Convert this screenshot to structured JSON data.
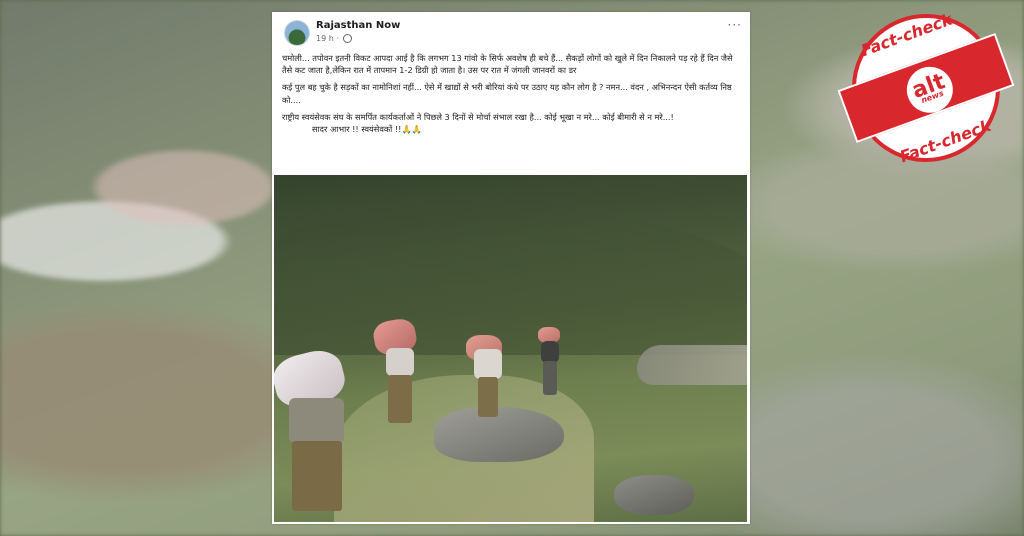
{
  "post": {
    "page_name": "Rajasthan Now",
    "time": "19 h ·",
    "more": "···",
    "paragraphs": [
      "चमोली... तपोवन इतनी विकट आपदा आई है कि लगभग 13 गांवो के सिर्फ अवशेष ही बचे हैं... सैकड़ों लोगों को खुले में दिन निकालने पड़ रहे हैं दिन जैसे तैसे कट जाता है,लेकिन रात में तापमान 1-2 डिग्री हो जाता है। उस पर रात में जंगली जानवरों का डर",
      "कई पुल बह चुके है सड़कों का नामोनिशां नहीं... ऐसे में खाद्यों से भरी बोरियां कंधे पर उठाए यह कौन लोग है ? नमन... वंदन , अभिनन्दन ऐसी कर्तव्य निष्ठ को....",
      "राष्ट्रीय स्वयंसेवक संघ के समर्पित कार्यकर्ताओं ने पिछले 3 दिनों से मोर्चा संभाल रखा है... कोई भूखा न मरे... कोई बीमारी से न मरे...!"
    ],
    "signoff": "सादर आभार !! स्वयंसेवकों !!🙏🙏"
  },
  "stamp": {
    "top": "Fact-check",
    "bottom": "Fact-check",
    "logo": "alt",
    "logo_sub": "news"
  },
  "colors": {
    "stamp_red": "#d9272e",
    "fb_text": "#1c1e21",
    "fb_meta": "#65676b"
  }
}
